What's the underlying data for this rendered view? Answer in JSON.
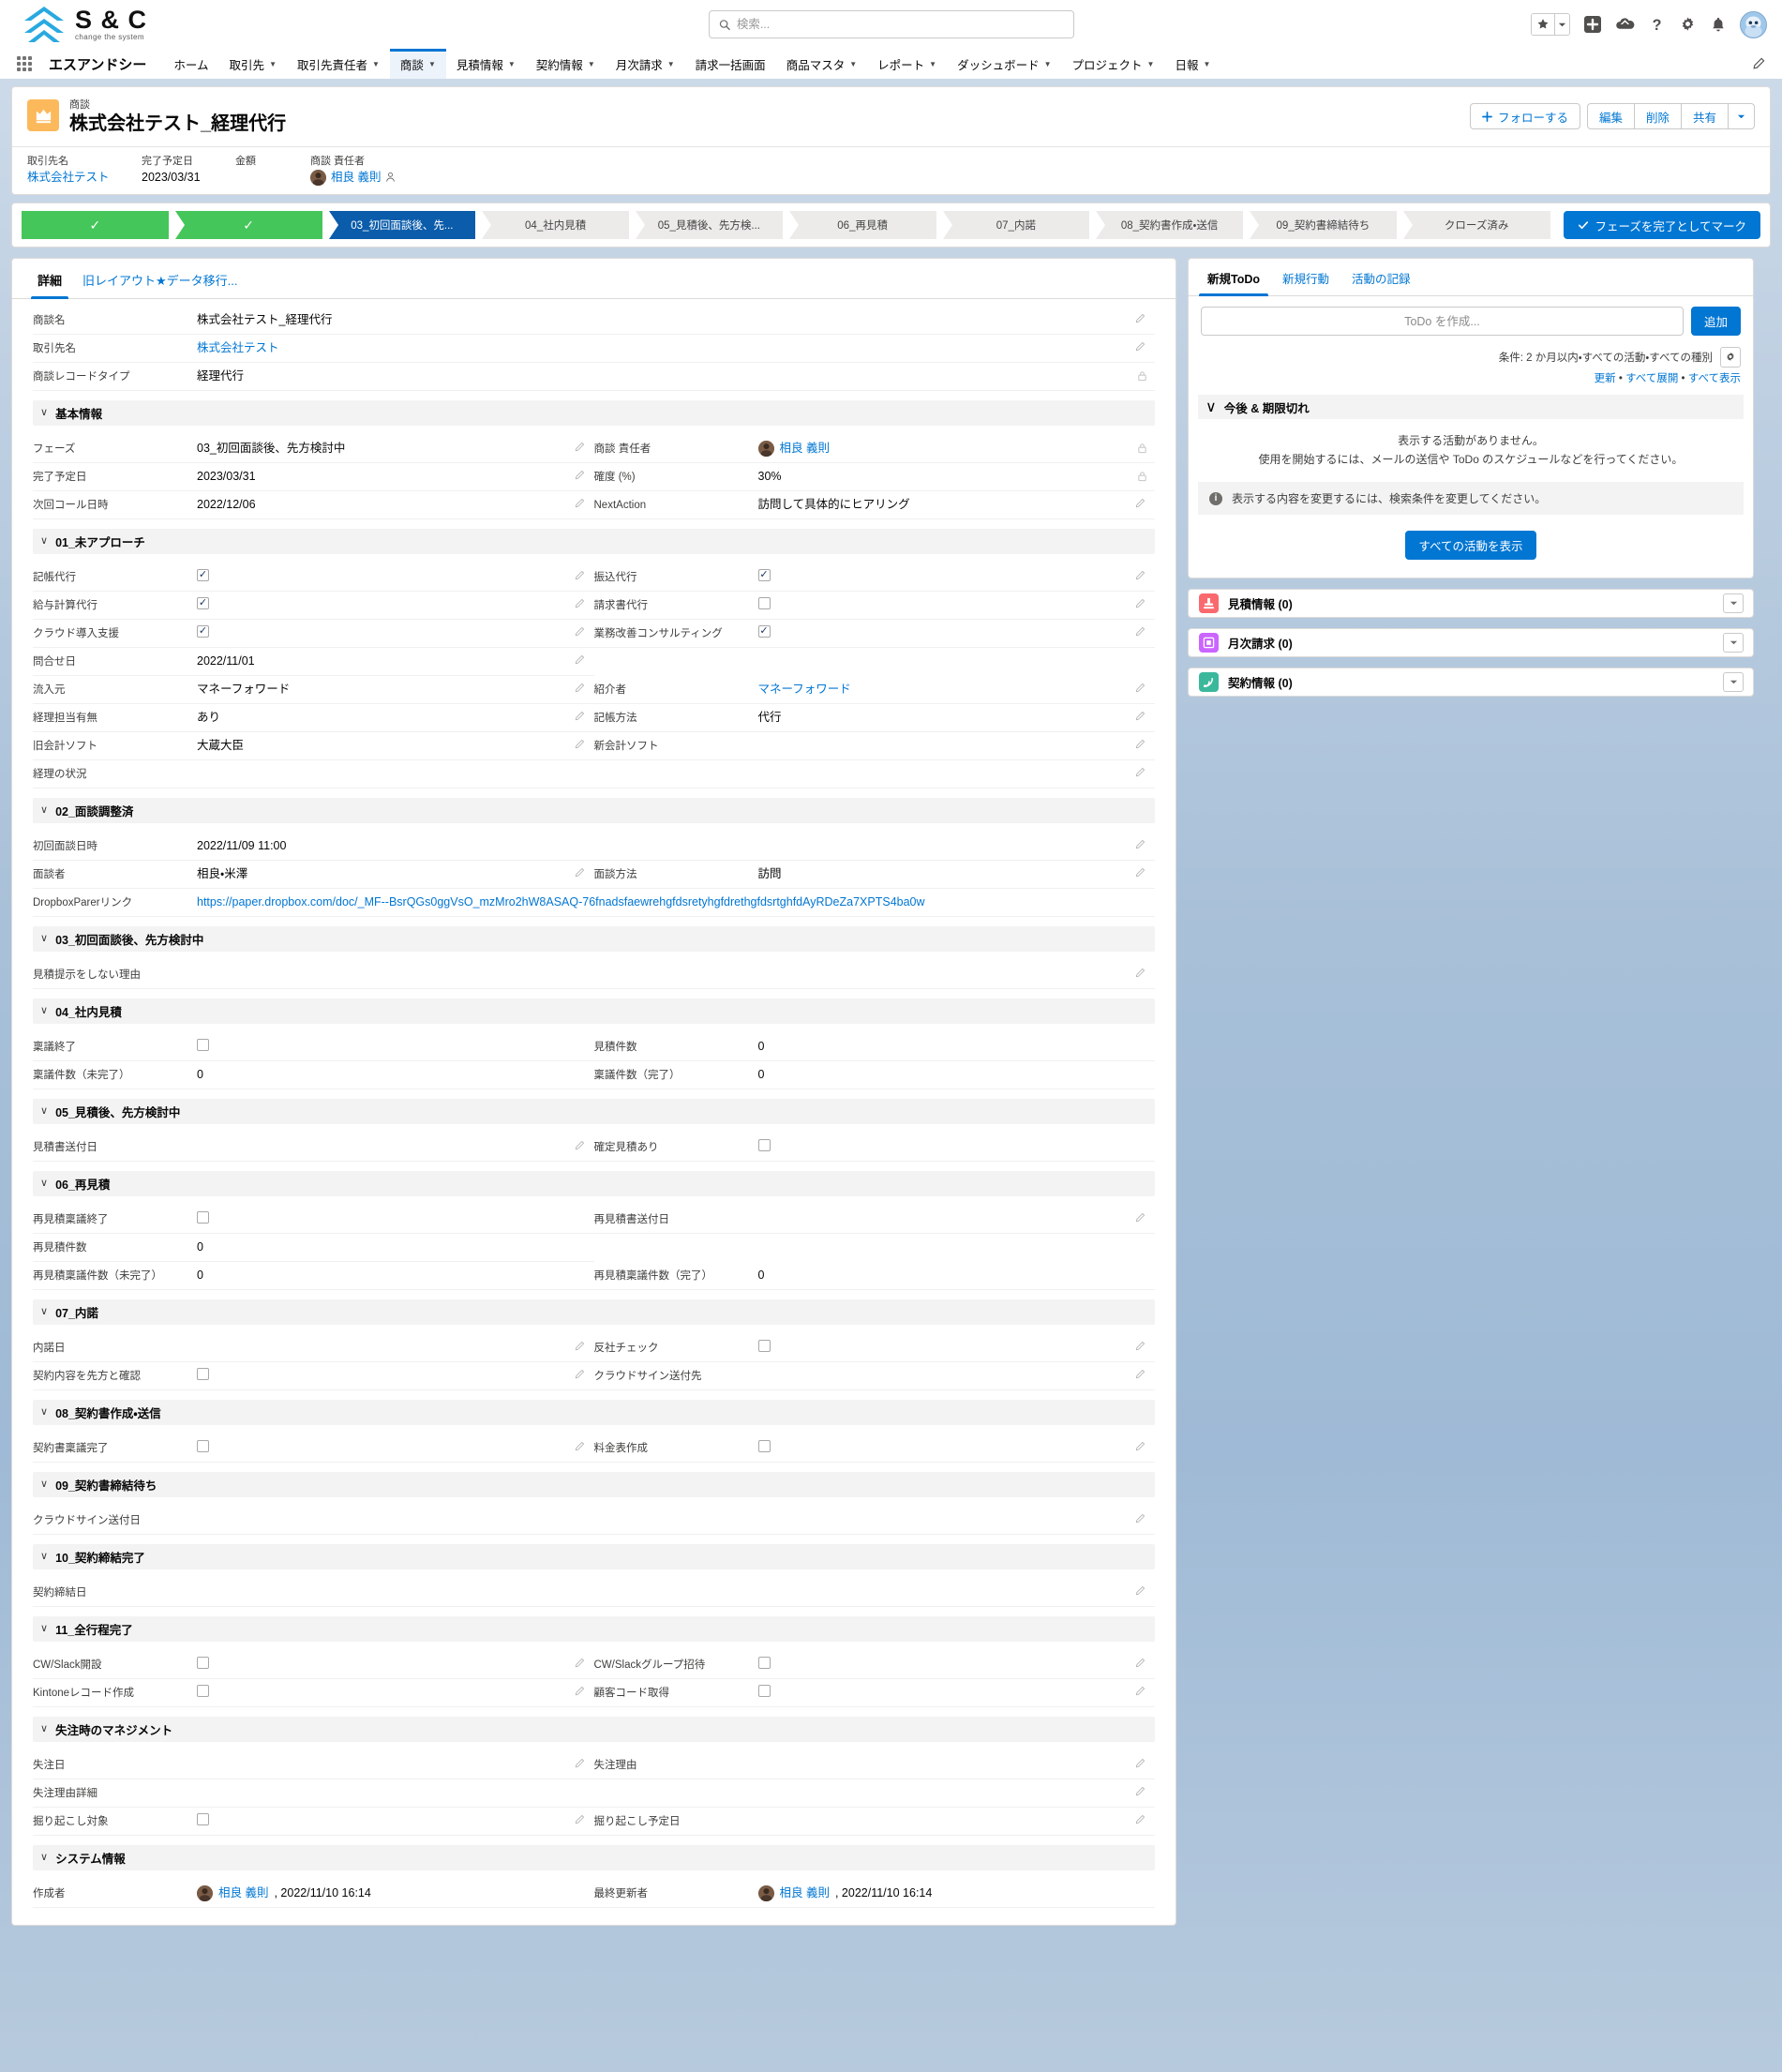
{
  "brand": {
    "logo_main": "S & C",
    "logo_sub": "change the system",
    "accent": "#0176d3",
    "path_done": "#45c65a",
    "path_current": "#0b5cab"
  },
  "global_header": {
    "search_placeholder": "検索...",
    "icons": [
      "favorites-star-icon",
      "favorites-caret-icon",
      "add-icon",
      "app-launcher-cloud-icon",
      "help-icon",
      "setup-gear-icon",
      "notifications-bell-icon",
      "user-avatar"
    ]
  },
  "app_nav": {
    "app_name": "エスアンドシー",
    "items": [
      {
        "label": "ホーム",
        "caret": false,
        "active": false
      },
      {
        "label": "取引先",
        "caret": true,
        "active": false
      },
      {
        "label": "取引先責任者",
        "caret": true,
        "active": false
      },
      {
        "label": "商談",
        "caret": true,
        "active": true
      },
      {
        "label": "見積情報",
        "caret": true,
        "active": false
      },
      {
        "label": "契約情報",
        "caret": true,
        "active": false
      },
      {
        "label": "月次請求",
        "caret": true,
        "active": false
      },
      {
        "label": "請求一括画面",
        "caret": false,
        "active": false
      },
      {
        "label": "商品マスタ",
        "caret": true,
        "active": false
      },
      {
        "label": "レポート",
        "caret": true,
        "active": false
      },
      {
        "label": "ダッシュボード",
        "caret": true,
        "active": false
      },
      {
        "label": "プロジェクト",
        "caret": true,
        "active": false
      },
      {
        "label": "日報",
        "caret": true,
        "active": false
      }
    ]
  },
  "record_header": {
    "object_label": "商談",
    "record_name": "株式会社テスト_経理代行",
    "follow_button": "フォローする",
    "buttons": [
      "編集",
      "削除",
      "共有"
    ],
    "fields": [
      {
        "label": "取引先名",
        "value": "株式会社テスト",
        "is_link": true
      },
      {
        "label": "完了予定日",
        "value": "2023/03/31",
        "is_link": false
      },
      {
        "label": "金額",
        "value": "",
        "is_link": false
      },
      {
        "label": "商談 責任者",
        "value": "相良 義則",
        "is_link": true,
        "avatar": true
      }
    ]
  },
  "path": {
    "steps": [
      {
        "label": "",
        "state": "done"
      },
      {
        "label": "",
        "state": "done"
      },
      {
        "label": "03_初回面談後、先...",
        "state": "current"
      },
      {
        "label": "04_社内見積",
        "state": "upcoming"
      },
      {
        "label": "05_見積後、先方検...",
        "state": "upcoming"
      },
      {
        "label": "06_再見積",
        "state": "upcoming"
      },
      {
        "label": "07_内諾",
        "state": "upcoming"
      },
      {
        "label": "08_契約書作成・送信",
        "state": "upcoming"
      },
      {
        "label": "09_契約書締結待ち",
        "state": "upcoming"
      },
      {
        "label": "クローズ済み",
        "state": "upcoming"
      }
    ],
    "mark_complete_button": "フェーズを完了としてマーク"
  },
  "detail": {
    "tabs": [
      {
        "label": "詳細",
        "active": true
      },
      {
        "label": "旧レイアウト★データ移行...",
        "active": false
      }
    ],
    "top_fields": [
      {
        "label": "商談名",
        "value": "株式会社テスト_経理代行",
        "type": "text",
        "editable": true
      },
      {
        "label": "取引先名",
        "value": "株式会社テスト",
        "type": "link",
        "editable": true
      },
      {
        "label": "商談レコードタイプ",
        "value": "経理代行",
        "type": "text",
        "editable": false,
        "locked": true
      }
    ],
    "sections": [
      {
        "title": "基本情報",
        "rows": [
          [
            {
              "label": "フェーズ",
              "value": "03_初回面談後、先方検討中",
              "type": "text",
              "editable": true
            },
            {
              "label": "商談 責任者",
              "value": "相良 義則",
              "type": "link-avatar",
              "editable": false,
              "locked": true
            }
          ],
          [
            {
              "label": "完了予定日",
              "value": "2023/03/31",
              "type": "text",
              "editable": true
            },
            {
              "label": "確度 (%)",
              "value": "30%",
              "type": "text",
              "editable": false,
              "locked": true
            }
          ],
          [
            {
              "label": "次回コール日時",
              "value": "2022/12/06",
              "type": "text",
              "editable": true
            },
            {
              "label": "NextAction",
              "value": "訪問して具体的にヒアリング",
              "type": "text",
              "editable": true
            }
          ]
        ]
      },
      {
        "title": "01_未アプローチ",
        "rows": [
          [
            {
              "label": "記帳代行",
              "value": true,
              "type": "checkbox",
              "editable": true
            },
            {
              "label": "振込代行",
              "value": true,
              "type": "checkbox",
              "editable": true
            }
          ],
          [
            {
              "label": "給与計算代行",
              "value": true,
              "type": "checkbox",
              "editable": true
            },
            {
              "label": "請求書代行",
              "value": false,
              "type": "checkbox",
              "editable": true
            }
          ],
          [
            {
              "label": "クラウド導入支援",
              "value": true,
              "type": "checkbox",
              "editable": true
            },
            {
              "label": "業務改善コンサルティング",
              "value": true,
              "type": "checkbox",
              "editable": true
            }
          ],
          [
            {
              "label": "問合せ日",
              "value": "2022/11/01",
              "type": "text",
              "editable": true
            },
            {
              "label": "",
              "value": "",
              "type": "blank",
              "editable": false
            }
          ],
          [
            {
              "label": "流入元",
              "value": "マネーフォワード",
              "type": "text",
              "editable": true
            },
            {
              "label": "紹介者",
              "value": "マネーフォワード",
              "type": "link",
              "editable": true
            }
          ],
          [
            {
              "label": "経理担当有無",
              "value": "あり",
              "type": "text",
              "editable": true
            },
            {
              "label": "記帳方法",
              "value": "代行",
              "type": "text",
              "editable": true
            }
          ],
          [
            {
              "label": "旧会計ソフト",
              "value": "大蔵大臣",
              "type": "text",
              "editable": true
            },
            {
              "label": "新会計ソフト",
              "value": "",
              "type": "text",
              "editable": true
            }
          ],
          [
            {
              "label": "経理の状況",
              "value": "",
              "type": "text",
              "editable": true,
              "full": true
            }
          ]
        ]
      },
      {
        "title": "02_面談調整済",
        "rows": [
          [
            {
              "label": "初回面談日時",
              "value": "2022/11/09 11:00",
              "type": "text",
              "editable": true,
              "full": true
            }
          ],
          [
            {
              "label": "面談者",
              "value": "相良・米澤",
              "type": "text",
              "editable": true
            },
            {
              "label": "面談方法",
              "value": "訪問",
              "type": "text",
              "editable": true
            }
          ],
          [
            {
              "label": "DropboxParerリンク",
              "value": "https://paper.dropbox.com/doc/_MF--BsrQGs0ggVsO_mzMro2hW8ASAQ-76fnadsfaewrehgfdsretyhgfdrethgfdsrtghfdAyRDeZa7XPTS4ba0w",
              "type": "link",
              "editable": false,
              "full": true
            }
          ]
        ]
      },
      {
        "title": "03_初回面談後、先方検討中",
        "rows": [
          [
            {
              "label": "見積提示をしない理由",
              "value": "",
              "type": "text",
              "editable": true,
              "full": true
            }
          ]
        ]
      },
      {
        "title": "04_社内見積",
        "rows": [
          [
            {
              "label": "稟議終了",
              "value": false,
              "type": "checkbox",
              "editable": false
            },
            {
              "label": "見積件数",
              "value": "0",
              "type": "text",
              "editable": false
            }
          ],
          [
            {
              "label": "稟議件数（未完了）",
              "value": "0",
              "type": "text",
              "editable": false
            },
            {
              "label": "稟議件数（完了）",
              "value": "0",
              "type": "text",
              "editable": false
            }
          ]
        ]
      },
      {
        "title": "05_見積後、先方検討中",
        "rows": [
          [
            {
              "label": "見積書送付日",
              "value": "",
              "type": "text",
              "editable": true
            },
            {
              "label": "確定見積あり",
              "value": false,
              "type": "checkbox",
              "editable": false
            }
          ]
        ]
      },
      {
        "title": "06_再見積",
        "rows": [
          [
            {
              "label": "再見積稟議終了",
              "value": false,
              "type": "checkbox",
              "editable": false
            },
            {
              "label": "再見積書送付日",
              "value": "",
              "type": "text",
              "editable": true
            }
          ],
          [
            {
              "label": "再見積件数",
              "value": "0",
              "type": "text",
              "editable": false
            },
            {
              "label": "",
              "value": "",
              "type": "blank",
              "editable": false
            }
          ],
          [
            {
              "label": "再見積稟議件数（未完了）",
              "value": "0",
              "type": "text",
              "editable": false
            },
            {
              "label": "再見積稟議件数（完了）",
              "value": "0",
              "type": "text",
              "editable": false
            }
          ]
        ]
      },
      {
        "title": "07_内諾",
        "rows": [
          [
            {
              "label": "内諾日",
              "value": "",
              "type": "text",
              "editable": true
            },
            {
              "label": "反社チェック",
              "value": false,
              "type": "checkbox",
              "editable": true
            }
          ],
          [
            {
              "label": "契約内容を先方と確認",
              "value": false,
              "type": "checkbox",
              "editable": true
            },
            {
              "label": "クラウドサイン送付先",
              "value": "",
              "type": "text",
              "editable": true
            }
          ]
        ]
      },
      {
        "title": "08_契約書作成・送信",
        "rows": [
          [
            {
              "label": "契約書稟議完了",
              "value": false,
              "type": "checkbox",
              "editable": true
            },
            {
              "label": "料金表作成",
              "value": false,
              "type": "checkbox",
              "editable": true
            }
          ]
        ]
      },
      {
        "title": "09_契約書締結待ち",
        "rows": [
          [
            {
              "label": "クラウドサイン送付日",
              "value": "",
              "type": "text",
              "editable": true,
              "full": true
            }
          ]
        ]
      },
      {
        "title": "10_契約締結完了",
        "rows": [
          [
            {
              "label": "契約締結日",
              "value": "",
              "type": "text",
              "editable": true,
              "full": true
            }
          ]
        ]
      },
      {
        "title": "11_全行程完了",
        "rows": [
          [
            {
              "label": "CW/Slack開設",
              "value": false,
              "type": "checkbox",
              "editable": true
            },
            {
              "label": "CW/Slackグループ招待",
              "value": false,
              "type": "checkbox",
              "editable": true
            }
          ],
          [
            {
              "label": "Kintoneレコード作成",
              "value": false,
              "type": "checkbox",
              "editable": true
            },
            {
              "label": "顧客コード取得",
              "value": false,
              "type": "checkbox",
              "editable": true
            }
          ]
        ]
      },
      {
        "title": "失注時のマネジメント",
        "rows": [
          [
            {
              "label": "失注日",
              "value": "",
              "type": "text",
              "editable": true
            },
            {
              "label": "失注理由",
              "value": "",
              "type": "text",
              "editable": true
            }
          ],
          [
            {
              "label": "失注理由詳細",
              "value": "",
              "type": "text",
              "editable": true,
              "full": true
            }
          ],
          [
            {
              "label": "掘り起こし対象",
              "value": false,
              "type": "checkbox",
              "editable": true
            },
            {
              "label": "掘り起こし予定日",
              "value": "",
              "type": "text",
              "editable": true
            }
          ]
        ]
      },
      {
        "title": "システム情報",
        "rows": [
          [
            {
              "label": "作成者",
              "value": "相良 義則",
              "suffix": ", 2022/11/10 16:14",
              "type": "link-avatar",
              "editable": false
            },
            {
              "label": "最終更新者",
              "value": "相良 義則",
              "suffix": ", 2022/11/10 16:14",
              "type": "link-avatar",
              "editable": false
            }
          ]
        ]
      }
    ]
  },
  "activity": {
    "tabs": [
      {
        "label": "新規ToDo",
        "active": true
      },
      {
        "label": "新規行動",
        "active": false
      },
      {
        "label": "活動の記録",
        "active": false
      }
    ],
    "todo_placeholder": "ToDo を作成...",
    "add_button": "追加",
    "filter_text": "条件: 2 か月以内・すべての活動・すべての種別",
    "links": [
      "更新",
      "すべて展開",
      "すべて表示"
    ],
    "upcoming_title": "今後 & 期限切れ",
    "empty_line1": "表示する活動がありません。",
    "empty_line2": "使用を開始するには、メールの送信や ToDo のスケジュールなどを行ってください。",
    "info_text": "表示する内容を変更するには、検索条件を変更してください。",
    "show_all_button": "すべての活動を表示"
  },
  "related_lists": [
    {
      "title": "見積情報 (0)",
      "icon": "quote-icon",
      "color": "#f9696e"
    },
    {
      "title": "月次請求 (0)",
      "icon": "invoice-icon",
      "color": "#cb65ff"
    },
    {
      "title": "契約情報 (0)",
      "icon": "contract-icon",
      "color": "#3bb89c"
    }
  ]
}
